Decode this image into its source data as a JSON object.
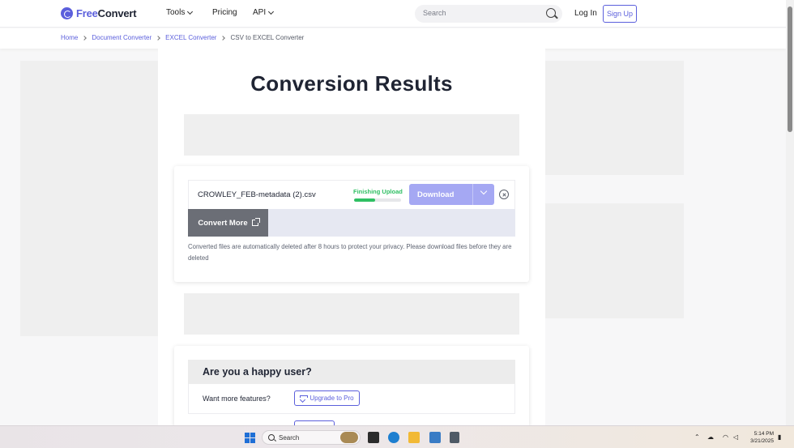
{
  "header": {
    "logo": {
      "part1": "Free",
      "part2": "Convert"
    },
    "nav": [
      {
        "label": "Tools",
        "has_dropdown": true
      },
      {
        "label": "Pricing",
        "has_dropdown": false
      },
      {
        "label": "API",
        "has_dropdown": true
      }
    ],
    "search_placeholder": "Search",
    "login_label": "Log In",
    "signup_label": "Sign Up"
  },
  "breadcrumb": [
    "Home",
    "Document Converter",
    "EXCEL Converter",
    "CSV to EXCEL Converter"
  ],
  "main": {
    "title": "Conversion Results",
    "file": {
      "name": "CROWLEY_FEB-metadata (2).csv",
      "status": "Finishing Upload",
      "progress": 0.45,
      "download_label": "Download"
    },
    "convert_more_label": "Convert More",
    "notice": "Converted files are automatically deleted after 8 hours to protect your privacy. Please download files before they are deleted",
    "happy": {
      "heading": "Are you a happy user?",
      "row_label": "Want more features?",
      "pro_button": "Upgrade to Pro"
    }
  },
  "colors": {
    "brand": "#5b5fdc",
    "status_green": "#2fbf63",
    "download_bg": "#a5a8f3",
    "convert_more_bg": "#6b6e76"
  },
  "taskbar": {
    "search_label": "Search",
    "time": "5:14 PM",
    "date": "3/21/2025"
  }
}
